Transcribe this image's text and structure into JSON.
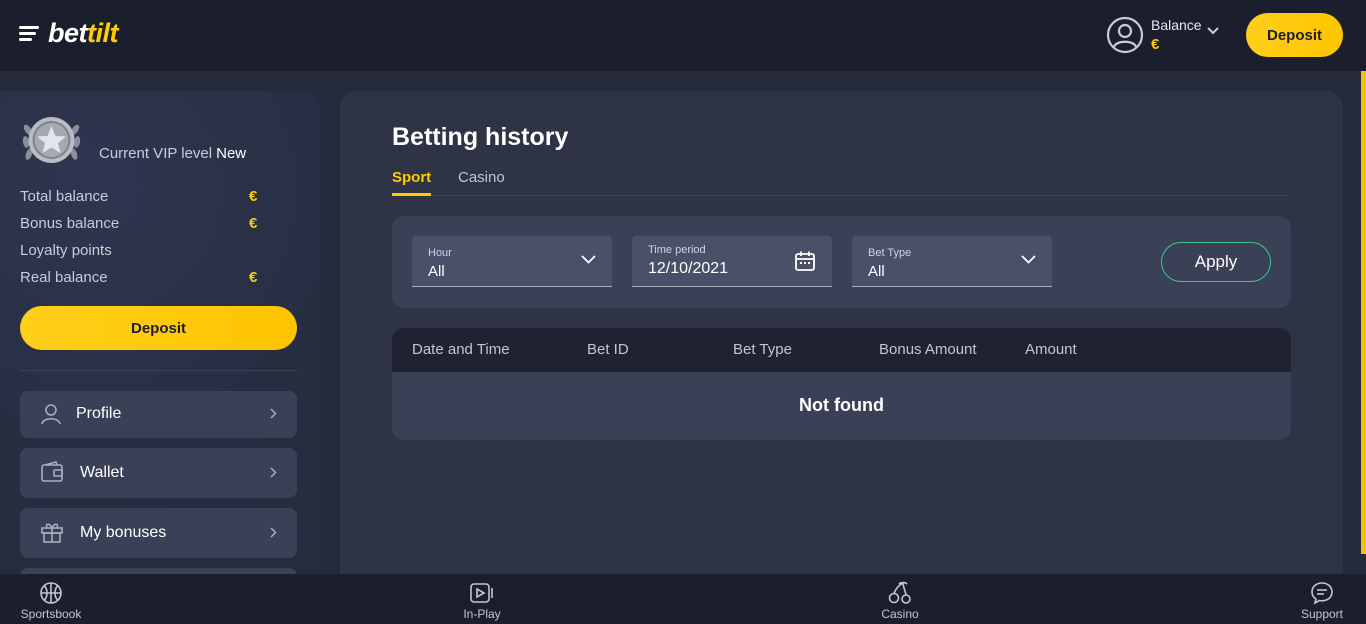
{
  "header": {
    "logo_part1": "bet",
    "logo_part2": "tilt",
    "balance_label": "Balance",
    "balance_value": "€",
    "deposit_label": "Deposit"
  },
  "sidebar": {
    "vip_prefix": "Current VIP level",
    "vip_level": "New",
    "balances": [
      {
        "label": "Total balance",
        "value": "€"
      },
      {
        "label": "Bonus balance",
        "value": "€"
      },
      {
        "label": "Loyalty points",
        "value": ""
      },
      {
        "label": "Real balance",
        "value": "€"
      }
    ],
    "deposit_label": "Deposit",
    "menu": [
      {
        "label": "Profile",
        "icon": "user-icon"
      },
      {
        "label": "Wallet",
        "icon": "wallet-icon"
      },
      {
        "label": "My bonuses",
        "icon": "gift-icon"
      }
    ]
  },
  "main": {
    "title": "Betting history",
    "tabs": [
      {
        "label": "Sport",
        "active": true
      },
      {
        "label": "Casino",
        "active": false
      }
    ],
    "filters": {
      "hour": {
        "label": "Hour",
        "value": "All"
      },
      "time_period": {
        "label": "Time period",
        "value": "12/10/2021"
      },
      "bet_type": {
        "label": "Bet Type",
        "value": "All"
      },
      "apply_label": "Apply"
    },
    "table": {
      "columns": [
        "Date and Time",
        "Bet ID",
        "Bet Type",
        "Bonus Amount",
        "Amount"
      ],
      "empty_message": "Not found"
    }
  },
  "bottom_nav": [
    {
      "label": "Sportsbook",
      "icon": "basketball-icon"
    },
    {
      "label": "In-Play",
      "icon": "play-icon"
    },
    {
      "label": "Casino",
      "icon": "cherries-icon"
    },
    {
      "label": "Support",
      "icon": "chat-icon"
    }
  ],
  "colors": {
    "accent": "#ffcc00",
    "background": "#252a3a",
    "panel": "#2e3346",
    "apply_border": "#38c98a"
  }
}
